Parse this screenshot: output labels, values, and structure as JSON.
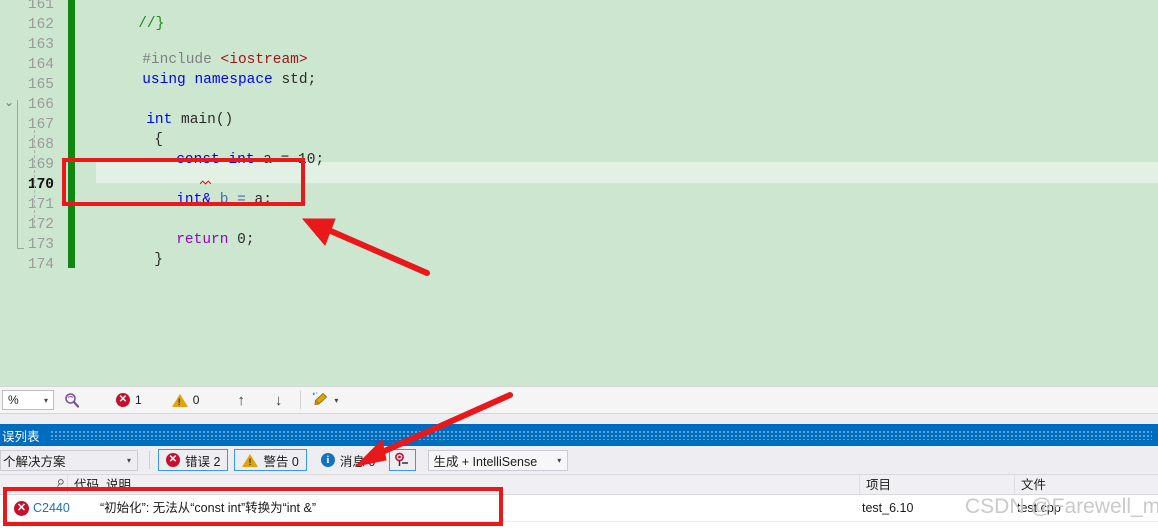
{
  "editor": {
    "background_color": "#CDE6D0",
    "current_line": 170,
    "change_bar_color": "#108710",
    "lines": [
      {
        "num": "161",
        "text": "//}"
      },
      {
        "num": "162",
        "text": ""
      },
      {
        "num": "163",
        "text": "#include <iostream>"
      },
      {
        "num": "164",
        "text": "using namespace std;"
      },
      {
        "num": "165",
        "text": ""
      },
      {
        "num": "166",
        "text": "int main()"
      },
      {
        "num": "167",
        "text": "{"
      },
      {
        "num": "168",
        "text": "    const int a = 10;"
      },
      {
        "num": "169",
        "text": ""
      },
      {
        "num": "170",
        "text": "    int& b = a;"
      },
      {
        "num": "171",
        "text": ""
      },
      {
        "num": "172",
        "text": "    return 0;"
      },
      {
        "num": "173",
        "text": "}"
      },
      {
        "num": "174",
        "text": ""
      }
    ],
    "tokens": {
      "include_directive": "#include",
      "include_header": "<iostream>",
      "using": "using",
      "namespace": "namespace",
      "std": "std;",
      "int": "int",
      "main": "main()",
      "open_brace": "{",
      "const": "const",
      "int2": "int",
      "a_decl": "a = 10;",
      "int3": "int&",
      "b_decl": "b = ",
      "a_ref": "a;",
      "return": "return",
      "zero": "0;",
      "close_brace": "}",
      "comment": "//}"
    }
  },
  "editor_toolbar": {
    "zoom_value": "%",
    "zoom_caret": "▾",
    "magnifier_icon": "magnifier-icon",
    "error_icon": "error-icon",
    "error_count": "1",
    "warning_icon": "warning-icon",
    "warning_count": "0",
    "up_arrow": "↑",
    "down_arrow": "↓",
    "broom_icon": "broom-icon",
    "broom_caret": "▾"
  },
  "error_list": {
    "title": "误列表",
    "scope_value": "个解决方案",
    "scope_caret": "▾",
    "filters": [
      {
        "name": "errors",
        "icon": "error-icon",
        "label": "错误 2"
      },
      {
        "name": "warnings",
        "icon": "warning-icon",
        "label": "警告 0"
      },
      {
        "name": "messages",
        "icon": "info-icon",
        "label": "消息 0"
      }
    ],
    "build_filter_icon": "build-error-filter-icon",
    "build_combo_value": "生成 + IntelliSense",
    "build_combo_caret": "▾",
    "columns": [
      {
        "key": "marker",
        "label": ""
      },
      {
        "key": "code",
        "label": "代码"
      },
      {
        "key": "description",
        "label": "说明"
      },
      {
        "key": "project",
        "label": "项目"
      },
      {
        "key": "file",
        "label": "文件"
      }
    ],
    "rows": [
      {
        "severity_icon": "error-icon",
        "code": "C2440",
        "description": "“初始化”: 无法从“const int”转换为“int &”",
        "project": "test_6.10",
        "file": "test.cpp"
      }
    ]
  },
  "annotations": {
    "accent_color": "#E8181B",
    "rect_code_line": "highlight-line-170",
    "rect_error_row": "highlight-error-row",
    "arrow_to_code": "arrow-pointing-at-line-170",
    "arrow_to_filter": "arrow-pointing-at-build-filter"
  },
  "watermark": {
    "text": "CSDN @Farewell_me"
  }
}
